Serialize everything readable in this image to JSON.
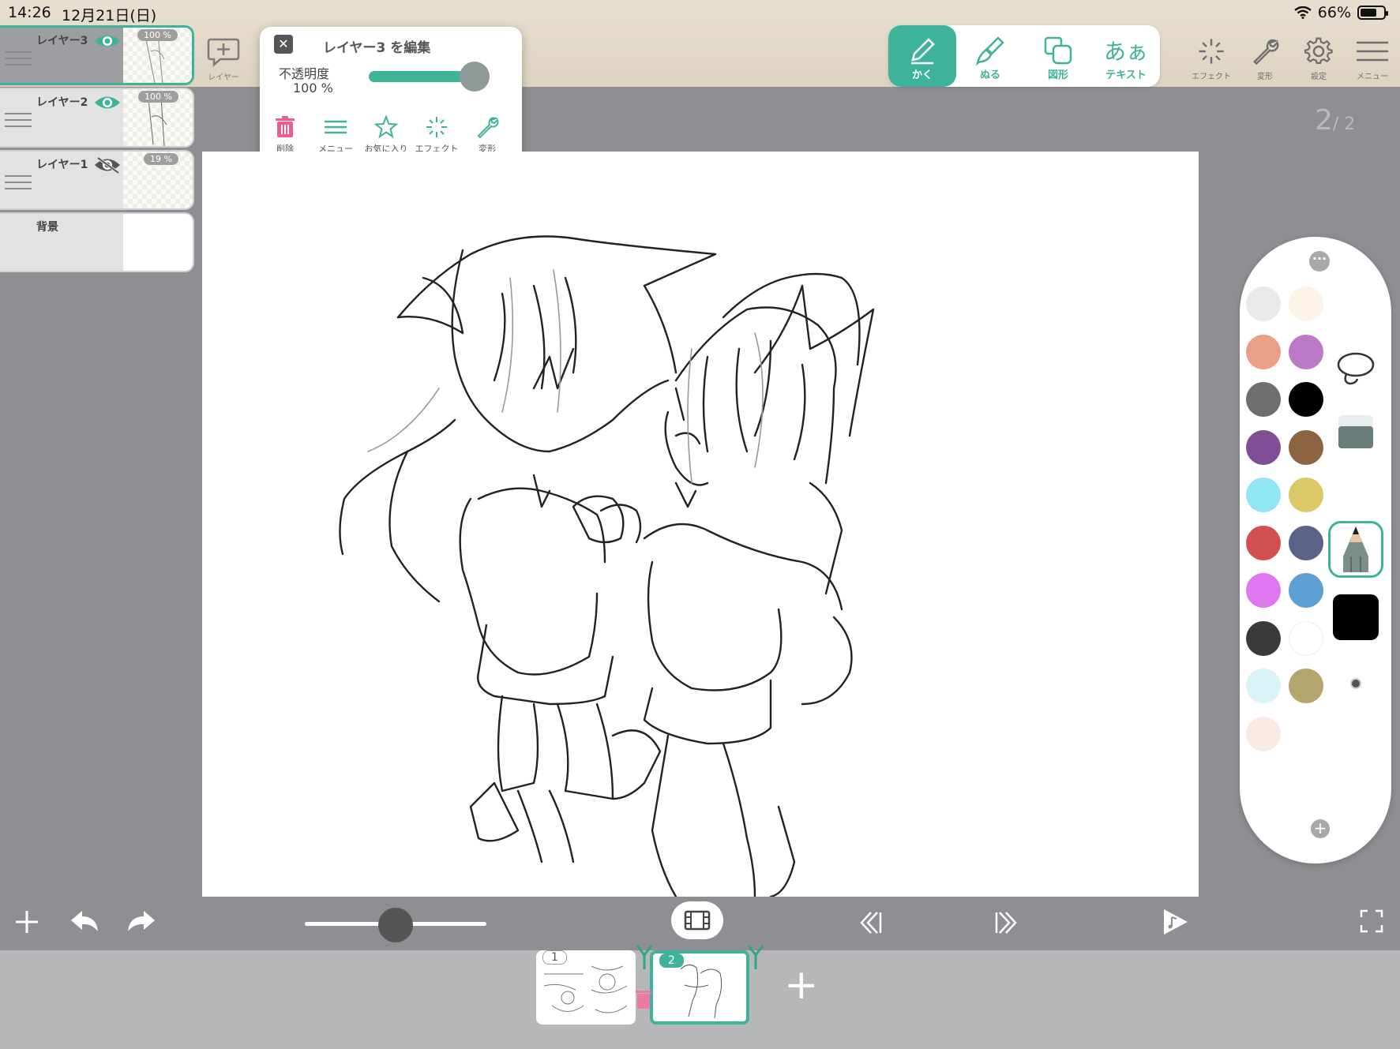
{
  "status": {
    "time": "14:26",
    "date": "12月21日(日)",
    "battery": "66%"
  },
  "layers": [
    {
      "name": "レイヤー3",
      "opacity": "100 %",
      "visible": true,
      "active": true
    },
    {
      "name": "レイヤー2",
      "opacity": "100 %",
      "visible": true,
      "active": false
    },
    {
      "name": "レイヤー1",
      "opacity": "19 %",
      "visible": false,
      "active": false
    },
    {
      "name": "背景",
      "opacity": "",
      "visible": true,
      "active": false
    }
  ],
  "add_layer_label": "レイヤー",
  "edit_popup": {
    "title": "レイヤー3 を編集",
    "opacity_label": "不透明度",
    "opacity_value": "100 %",
    "opacity_fraction": 1.0,
    "actions": [
      "削除",
      "メニュー",
      "お気に入り",
      "エフェクト",
      "変形"
    ]
  },
  "tool_tabs": [
    {
      "label": "かく",
      "icon": "pen-icon",
      "active": true
    },
    {
      "label": "ぬる",
      "icon": "brush-icon",
      "active": false
    },
    {
      "label": "図形",
      "icon": "shapes-icon",
      "active": false
    },
    {
      "label": "テキスト",
      "icon": "text-icon",
      "glyph": "あぁ",
      "active": false
    }
  ],
  "top_tools": [
    "エフェクト",
    "変形",
    "設定",
    "メニュー"
  ],
  "page_counter": {
    "current": "2",
    "total": "/ 2"
  },
  "palette": {
    "colors": [
      "#e9e9e9",
      "#fdf3e6",
      "#e9a089",
      "#bc79c7",
      "#6e6e6e",
      "#000000",
      "#7e4f96",
      "#8d6441",
      "#8fe7f3",
      "#dac966",
      "#d2504f",
      "#5b6384",
      "#e076f2",
      "#5e9fd4",
      "#3a3a3a",
      "#ffffff",
      "#d9f4f8",
      "#b3a56d",
      "#fbe9e6",
      ""
    ],
    "tools": [
      "lasso-icon",
      "eraser-icon",
      "pencil-icon",
      "color-black-icon",
      "brush-size-icon"
    ],
    "accent": "#3fb39a"
  },
  "frames": [
    {
      "number": "1",
      "active": false
    },
    {
      "number": "2",
      "active": true
    }
  ],
  "zoom_level": 0.45
}
